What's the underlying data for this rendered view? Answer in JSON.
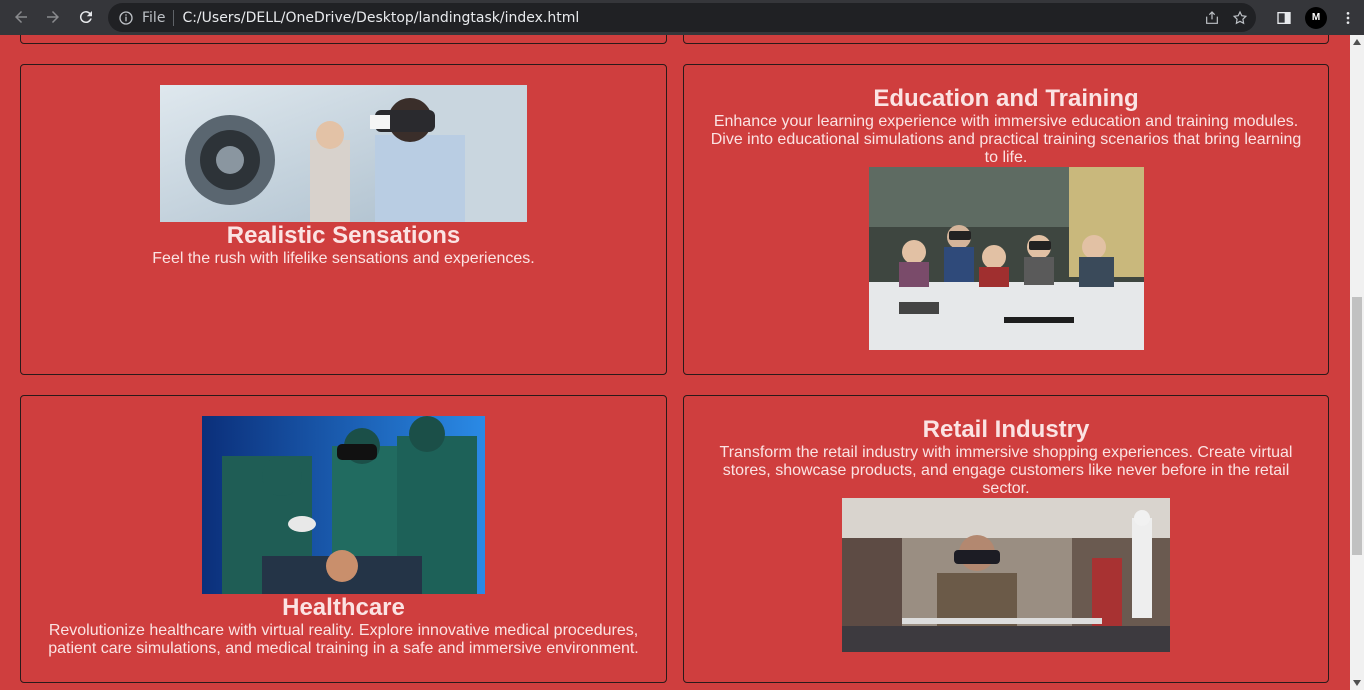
{
  "browser": {
    "file_label": "File",
    "url": "C:/Users/DELL/OneDrive/Desktop/landingtask/index.html",
    "profile_initial": "M"
  },
  "cards": [
    {
      "title": "Realistic Sensations",
      "text": "Feel the rush with lifelike sensations and experiences."
    },
    {
      "title": "Education and Training",
      "text": "Enhance your learning experience with immersive education and training modules. Dive into educational simulations and practical training scenarios that bring learning to life."
    },
    {
      "title": "Healthcare",
      "text": "Revolutionize healthcare with virtual reality. Explore innovative medical procedures, patient care simulations, and medical training in a safe and immersive environment."
    },
    {
      "title": "Retail Industry",
      "text": "Transform the retail industry with immersive shopping experiences. Create virtual stores, showcase products, and engage customers like never before in the retail sector."
    }
  ],
  "colors": {
    "page_bg": "#cf3e3e",
    "chrome_bg": "#35363a",
    "omnibox_bg": "#202124"
  }
}
